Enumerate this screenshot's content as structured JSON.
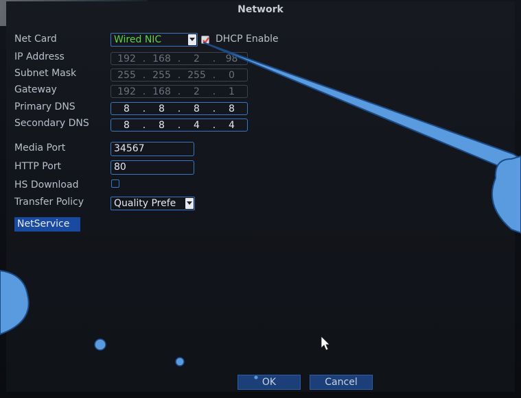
{
  "title": "Network",
  "net_card": {
    "label": "Net Card",
    "value": "Wired NIC"
  },
  "dhcp": {
    "label": "DHCP Enable",
    "checked": true
  },
  "ip_address": {
    "label": "IP Address",
    "octets": [
      "192",
      "168",
      "2",
      "98"
    ]
  },
  "subnet_mask": {
    "label": "Subnet Mask",
    "octets": [
      "255",
      "255",
      "255",
      "0"
    ]
  },
  "gateway": {
    "label": "Gateway",
    "octets": [
      "192",
      "168",
      "2",
      "1"
    ]
  },
  "primary_dns": {
    "label": "Primary DNS",
    "octets": [
      "8",
      "8",
      "8",
      "8"
    ]
  },
  "secondary_dns": {
    "label": "Secondary DNS",
    "octets": [
      "8",
      "8",
      "4",
      "4"
    ]
  },
  "media_port": {
    "label": "Media Port",
    "value": "34567"
  },
  "http_port": {
    "label": "HTTP Port",
    "value": "80"
  },
  "hs_download": {
    "label": "HS Download",
    "checked": false
  },
  "transfer_policy": {
    "label": "Transfer Policy",
    "value": "Quality Prefe"
  },
  "net_service": {
    "label": "NetService"
  },
  "buttons": {
    "ok": "OK",
    "cancel": "Cancel"
  },
  "colors": {
    "label_text": "#b8c0cc",
    "field_border": "#3a78c0",
    "selected_green": "#5fd14a",
    "button_blue": "#1c3f7a",
    "annotation_blue": "#5a9be0",
    "checkbox_red": "#e04040"
  },
  "icons": {
    "dropdown": "chevron-down-icon",
    "dhcp_check": "checkmark-icon",
    "pointer": "mouse-pointer-icon"
  }
}
